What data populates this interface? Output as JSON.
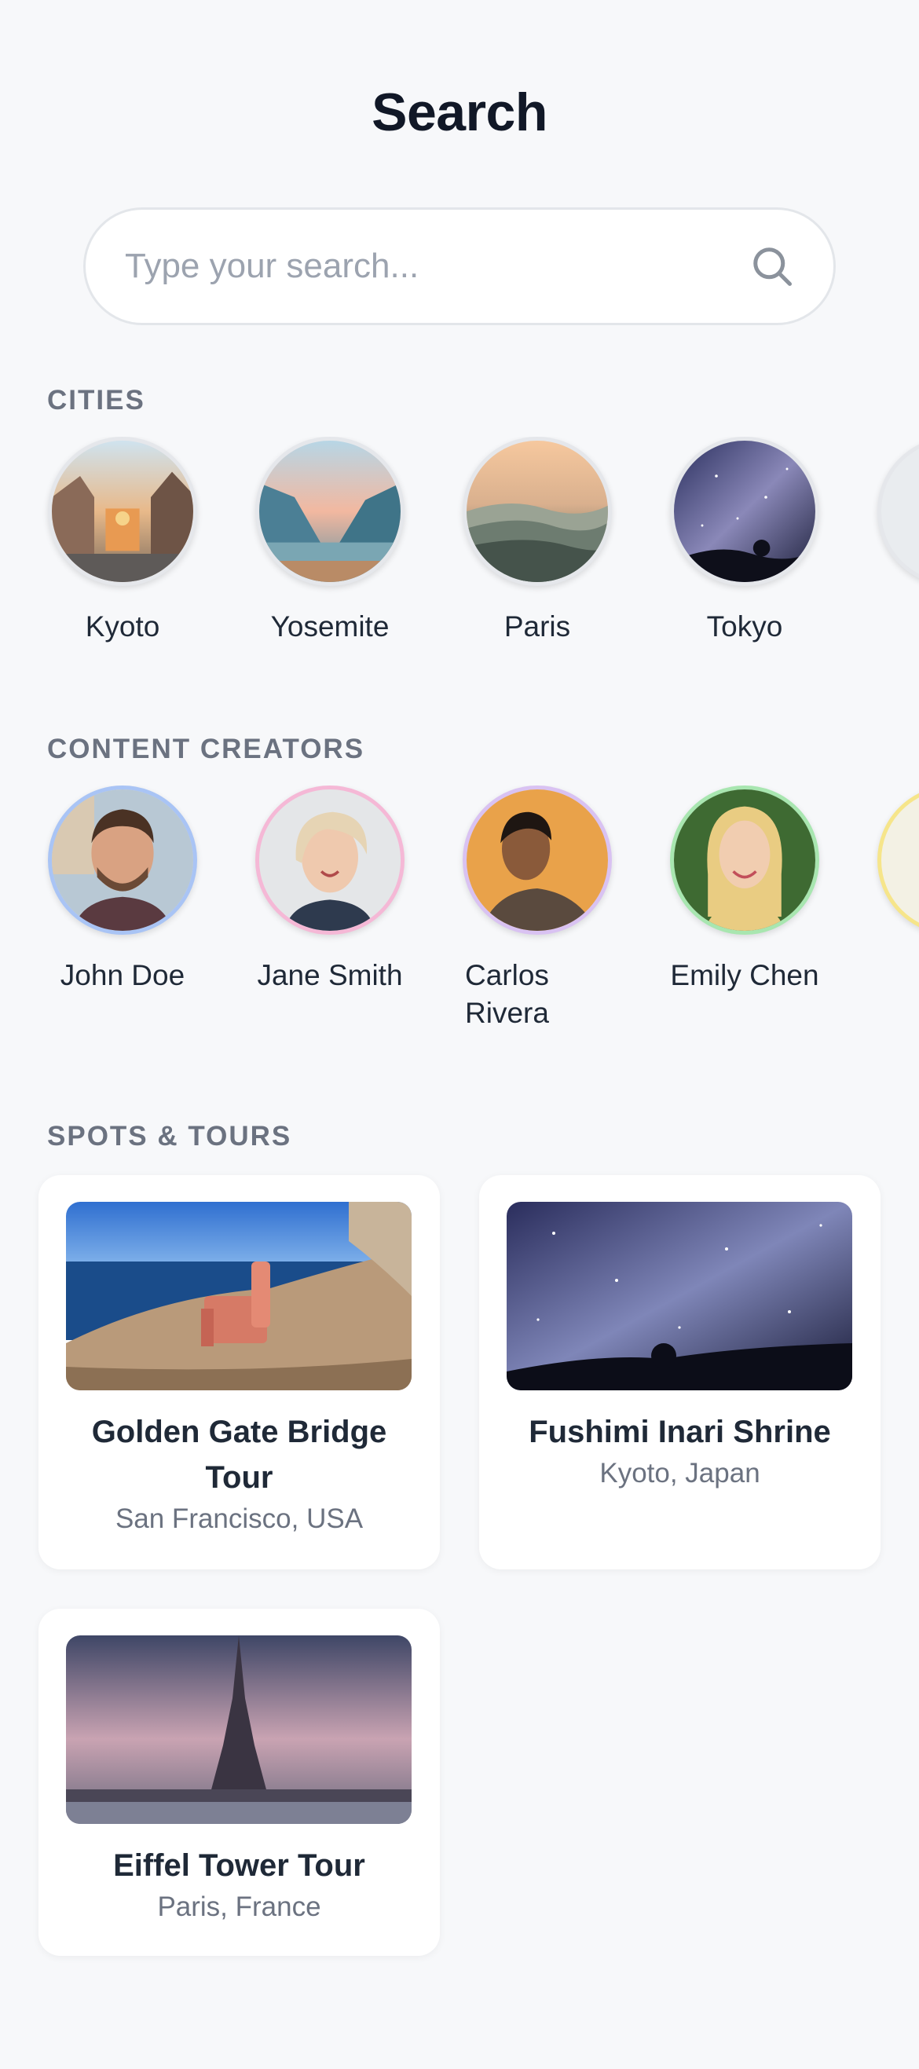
{
  "header": {
    "title": "Search"
  },
  "search": {
    "placeholder": "Type your search..."
  },
  "sections": {
    "cities": {
      "title": "CITIES",
      "items": [
        {
          "label": "Kyoto"
        },
        {
          "label": "Yosemite"
        },
        {
          "label": "Paris"
        },
        {
          "label": "Tokyo"
        }
      ]
    },
    "creators": {
      "title": "CONTENT CREATORS",
      "items": [
        {
          "label": "John Doe",
          "ring_color": "#a9c4f5"
        },
        {
          "label": "Jane Smith",
          "ring_color": "#f5b8d6"
        },
        {
          "label": "Carlos Rivera",
          "ring_color": "#d9c2f2"
        },
        {
          "label": "Emily Chen",
          "ring_color": "#a8e6b0"
        }
      ]
    },
    "spots": {
      "title": "SPOTS & TOURS",
      "items": [
        {
          "title": "Golden Gate Bridge Tour",
          "subtitle": "San Francisco, USA"
        },
        {
          "title": "Fushimi Inari Shrine",
          "subtitle": "Kyoto, Japan"
        },
        {
          "title": "Eiffel Tower Tour",
          "subtitle": "Paris, France"
        }
      ]
    }
  },
  "icons": {
    "search": "search-icon"
  },
  "colors": {
    "background": "#f7f8fa",
    "title": "#111827",
    "muted": "#6b7280"
  }
}
